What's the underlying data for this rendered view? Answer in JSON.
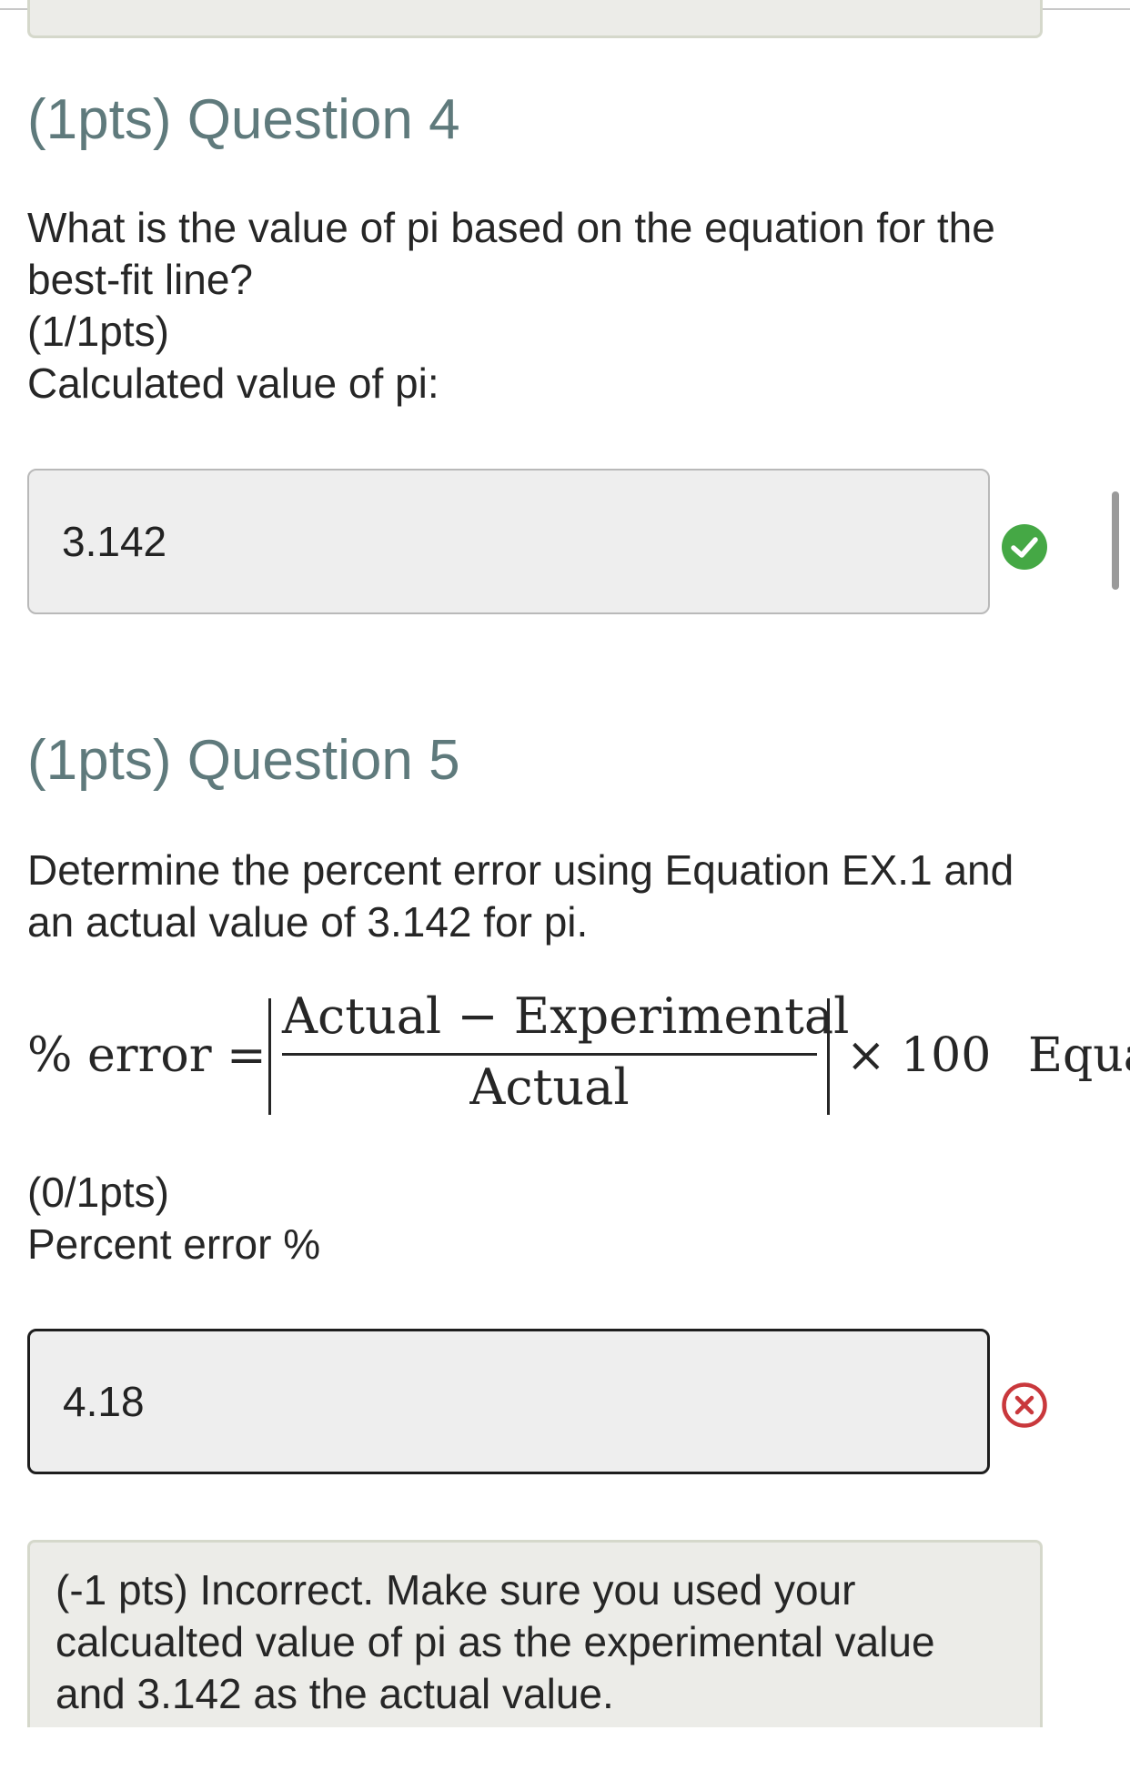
{
  "q4": {
    "title": "(1pts) Question 4",
    "text_line1": "What is the value of pi based on the equation for the",
    "text_line2": "best-fit line?",
    "score": "(1/1pts)",
    "field_label": "Calculated value of pi:",
    "answer": "3.142",
    "status_icon": "check-circle-icon",
    "status_color": "#45a845"
  },
  "q5": {
    "title": "(1pts) Question 5",
    "text_line1": "Determine the percent error using Equation EX.1 and",
    "text_line2": "an actual value of 3.142 for pi.",
    "formula": {
      "lhs": "% error =",
      "numerator": "Actual − Experimental",
      "denominator": "Actual",
      "multiplier": "× 100",
      "label": "Equa"
    },
    "score": "(0/1pts)",
    "field_label": "Percent error %",
    "answer": "4.18",
    "status_icon": "x-circle-icon",
    "status_color": "#c9383c",
    "feedback_line1": "(-1 pts) Incorrect. Make sure you used your",
    "feedback_line2": "calcualted value of pi as the experimental value",
    "feedback_line3": "and 3.142 as the actual value."
  }
}
